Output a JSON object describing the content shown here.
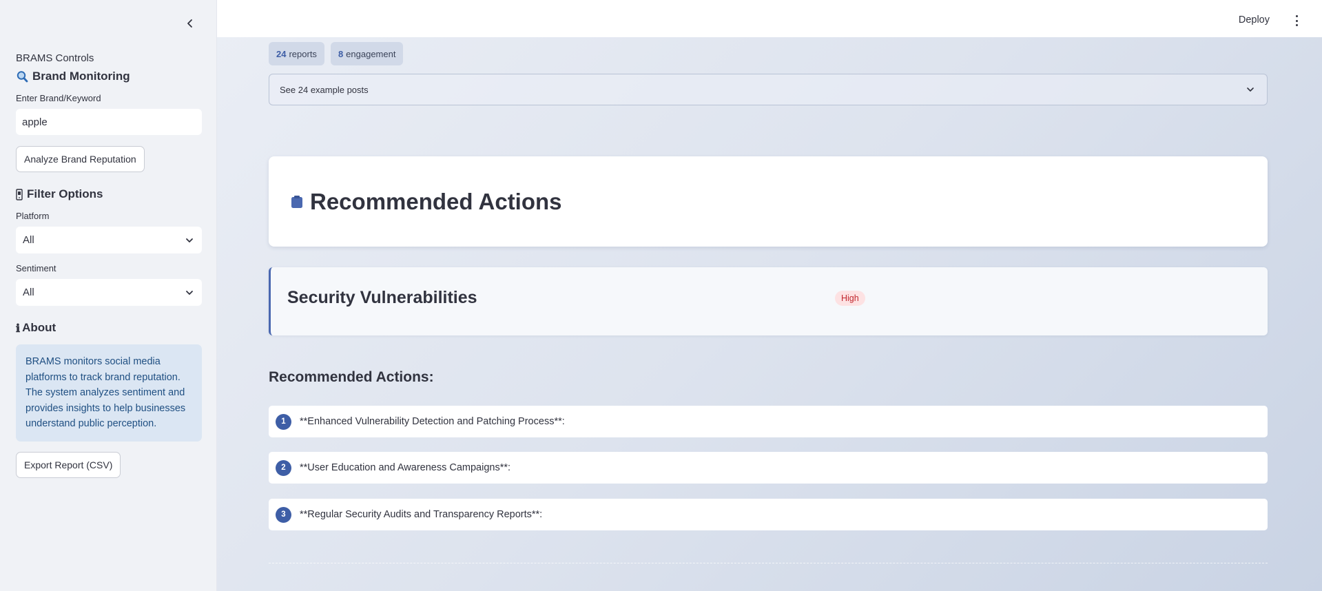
{
  "sidebar": {
    "controls_caption": "BRAMS Controls",
    "brand_monitoring": {
      "icon": "magnifier-icon",
      "title": "Brand Monitoring"
    },
    "keyword_label": "Enter Brand/Keyword",
    "keyword_value": "apple",
    "analyze_button": "Analyze Brand Reputation",
    "filter_options": {
      "icon": "phone-icon",
      "title": "Filter Options"
    },
    "platform_label": "Platform",
    "platform_value": "All",
    "sentiment_label": "Sentiment",
    "sentiment_value": "All",
    "about": {
      "icon": "info-icon",
      "title": "About"
    },
    "about_text": "BRAMS monitors social media platforms to track brand reputation. The system analyzes sentiment and provides insights to help businesses understand public perception.",
    "export_button": "Export Report (CSV)"
  },
  "header": {
    "deploy_label": "Deploy"
  },
  "main": {
    "chips": [
      {
        "value": "24",
        "label": "reports"
      },
      {
        "value": "8",
        "label": "engagement"
      }
    ],
    "expander_label": "See 24 example posts",
    "recommended_header": {
      "icon": "clipboard-icon",
      "title": "Recommended Actions"
    },
    "issue": {
      "title": "Security Vulnerabilities",
      "severity": "High"
    },
    "actions_heading": "Recommended Actions:",
    "actions": [
      {
        "number": "1",
        "text": "**Enhanced Vulnerability Detection and Patching Process**:"
      },
      {
        "number": "2",
        "text": "**User Education and Awareness Campaigns**:"
      },
      {
        "number": "3",
        "text": "**Regular Security Audits and Transparency Reports**:"
      }
    ]
  },
  "colors": {
    "accent": "#3e5ea6",
    "severity_high_bg": "#fde2e3",
    "severity_high_text": "#c0262d",
    "info_bg": "#dbe6f3",
    "info_text": "#1f4f82"
  }
}
